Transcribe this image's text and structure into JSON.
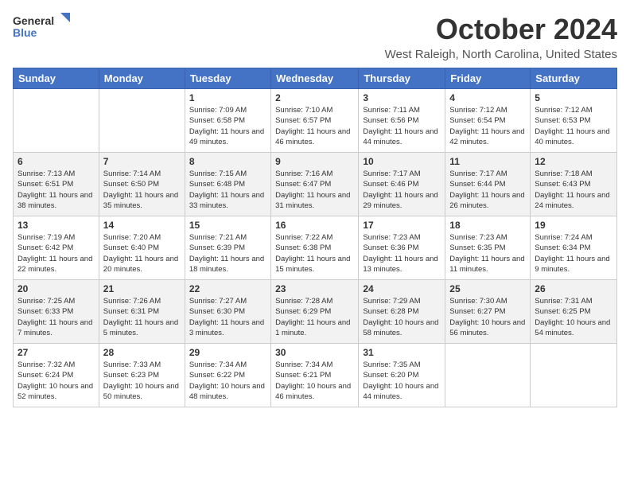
{
  "logo": {
    "line1": "General",
    "line2": "Blue"
  },
  "title": "October 2024",
  "subtitle": "West Raleigh, North Carolina, United States",
  "weekdays": [
    "Sunday",
    "Monday",
    "Tuesday",
    "Wednesday",
    "Thursday",
    "Friday",
    "Saturday"
  ],
  "weeks": [
    [
      {
        "day": "",
        "sunrise": "",
        "sunset": "",
        "daylight": ""
      },
      {
        "day": "",
        "sunrise": "",
        "sunset": "",
        "daylight": ""
      },
      {
        "day": "1",
        "sunrise": "Sunrise: 7:09 AM",
        "sunset": "Sunset: 6:58 PM",
        "daylight": "Daylight: 11 hours and 49 minutes."
      },
      {
        "day": "2",
        "sunrise": "Sunrise: 7:10 AM",
        "sunset": "Sunset: 6:57 PM",
        "daylight": "Daylight: 11 hours and 46 minutes."
      },
      {
        "day": "3",
        "sunrise": "Sunrise: 7:11 AM",
        "sunset": "Sunset: 6:56 PM",
        "daylight": "Daylight: 11 hours and 44 minutes."
      },
      {
        "day": "4",
        "sunrise": "Sunrise: 7:12 AM",
        "sunset": "Sunset: 6:54 PM",
        "daylight": "Daylight: 11 hours and 42 minutes."
      },
      {
        "day": "5",
        "sunrise": "Sunrise: 7:12 AM",
        "sunset": "Sunset: 6:53 PM",
        "daylight": "Daylight: 11 hours and 40 minutes."
      }
    ],
    [
      {
        "day": "6",
        "sunrise": "Sunrise: 7:13 AM",
        "sunset": "Sunset: 6:51 PM",
        "daylight": "Daylight: 11 hours and 38 minutes."
      },
      {
        "day": "7",
        "sunrise": "Sunrise: 7:14 AM",
        "sunset": "Sunset: 6:50 PM",
        "daylight": "Daylight: 11 hours and 35 minutes."
      },
      {
        "day": "8",
        "sunrise": "Sunrise: 7:15 AM",
        "sunset": "Sunset: 6:48 PM",
        "daylight": "Daylight: 11 hours and 33 minutes."
      },
      {
        "day": "9",
        "sunrise": "Sunrise: 7:16 AM",
        "sunset": "Sunset: 6:47 PM",
        "daylight": "Daylight: 11 hours and 31 minutes."
      },
      {
        "day": "10",
        "sunrise": "Sunrise: 7:17 AM",
        "sunset": "Sunset: 6:46 PM",
        "daylight": "Daylight: 11 hours and 29 minutes."
      },
      {
        "day": "11",
        "sunrise": "Sunrise: 7:17 AM",
        "sunset": "Sunset: 6:44 PM",
        "daylight": "Daylight: 11 hours and 26 minutes."
      },
      {
        "day": "12",
        "sunrise": "Sunrise: 7:18 AM",
        "sunset": "Sunset: 6:43 PM",
        "daylight": "Daylight: 11 hours and 24 minutes."
      }
    ],
    [
      {
        "day": "13",
        "sunrise": "Sunrise: 7:19 AM",
        "sunset": "Sunset: 6:42 PM",
        "daylight": "Daylight: 11 hours and 22 minutes."
      },
      {
        "day": "14",
        "sunrise": "Sunrise: 7:20 AM",
        "sunset": "Sunset: 6:40 PM",
        "daylight": "Daylight: 11 hours and 20 minutes."
      },
      {
        "day": "15",
        "sunrise": "Sunrise: 7:21 AM",
        "sunset": "Sunset: 6:39 PM",
        "daylight": "Daylight: 11 hours and 18 minutes."
      },
      {
        "day": "16",
        "sunrise": "Sunrise: 7:22 AM",
        "sunset": "Sunset: 6:38 PM",
        "daylight": "Daylight: 11 hours and 15 minutes."
      },
      {
        "day": "17",
        "sunrise": "Sunrise: 7:23 AM",
        "sunset": "Sunset: 6:36 PM",
        "daylight": "Daylight: 11 hours and 13 minutes."
      },
      {
        "day": "18",
        "sunrise": "Sunrise: 7:23 AM",
        "sunset": "Sunset: 6:35 PM",
        "daylight": "Daylight: 11 hours and 11 minutes."
      },
      {
        "day": "19",
        "sunrise": "Sunrise: 7:24 AM",
        "sunset": "Sunset: 6:34 PM",
        "daylight": "Daylight: 11 hours and 9 minutes."
      }
    ],
    [
      {
        "day": "20",
        "sunrise": "Sunrise: 7:25 AM",
        "sunset": "Sunset: 6:33 PM",
        "daylight": "Daylight: 11 hours and 7 minutes."
      },
      {
        "day": "21",
        "sunrise": "Sunrise: 7:26 AM",
        "sunset": "Sunset: 6:31 PM",
        "daylight": "Daylight: 11 hours and 5 minutes."
      },
      {
        "day": "22",
        "sunrise": "Sunrise: 7:27 AM",
        "sunset": "Sunset: 6:30 PM",
        "daylight": "Daylight: 11 hours and 3 minutes."
      },
      {
        "day": "23",
        "sunrise": "Sunrise: 7:28 AM",
        "sunset": "Sunset: 6:29 PM",
        "daylight": "Daylight: 11 hours and 1 minute."
      },
      {
        "day": "24",
        "sunrise": "Sunrise: 7:29 AM",
        "sunset": "Sunset: 6:28 PM",
        "daylight": "Daylight: 10 hours and 58 minutes."
      },
      {
        "day": "25",
        "sunrise": "Sunrise: 7:30 AM",
        "sunset": "Sunset: 6:27 PM",
        "daylight": "Daylight: 10 hours and 56 minutes."
      },
      {
        "day": "26",
        "sunrise": "Sunrise: 7:31 AM",
        "sunset": "Sunset: 6:25 PM",
        "daylight": "Daylight: 10 hours and 54 minutes."
      }
    ],
    [
      {
        "day": "27",
        "sunrise": "Sunrise: 7:32 AM",
        "sunset": "Sunset: 6:24 PM",
        "daylight": "Daylight: 10 hours and 52 minutes."
      },
      {
        "day": "28",
        "sunrise": "Sunrise: 7:33 AM",
        "sunset": "Sunset: 6:23 PM",
        "daylight": "Daylight: 10 hours and 50 minutes."
      },
      {
        "day": "29",
        "sunrise": "Sunrise: 7:34 AM",
        "sunset": "Sunset: 6:22 PM",
        "daylight": "Daylight: 10 hours and 48 minutes."
      },
      {
        "day": "30",
        "sunrise": "Sunrise: 7:34 AM",
        "sunset": "Sunset: 6:21 PM",
        "daylight": "Daylight: 10 hours and 46 minutes."
      },
      {
        "day": "31",
        "sunrise": "Sunrise: 7:35 AM",
        "sunset": "Sunset: 6:20 PM",
        "daylight": "Daylight: 10 hours and 44 minutes."
      },
      {
        "day": "",
        "sunrise": "",
        "sunset": "",
        "daylight": ""
      },
      {
        "day": "",
        "sunrise": "",
        "sunset": "",
        "daylight": ""
      }
    ]
  ]
}
